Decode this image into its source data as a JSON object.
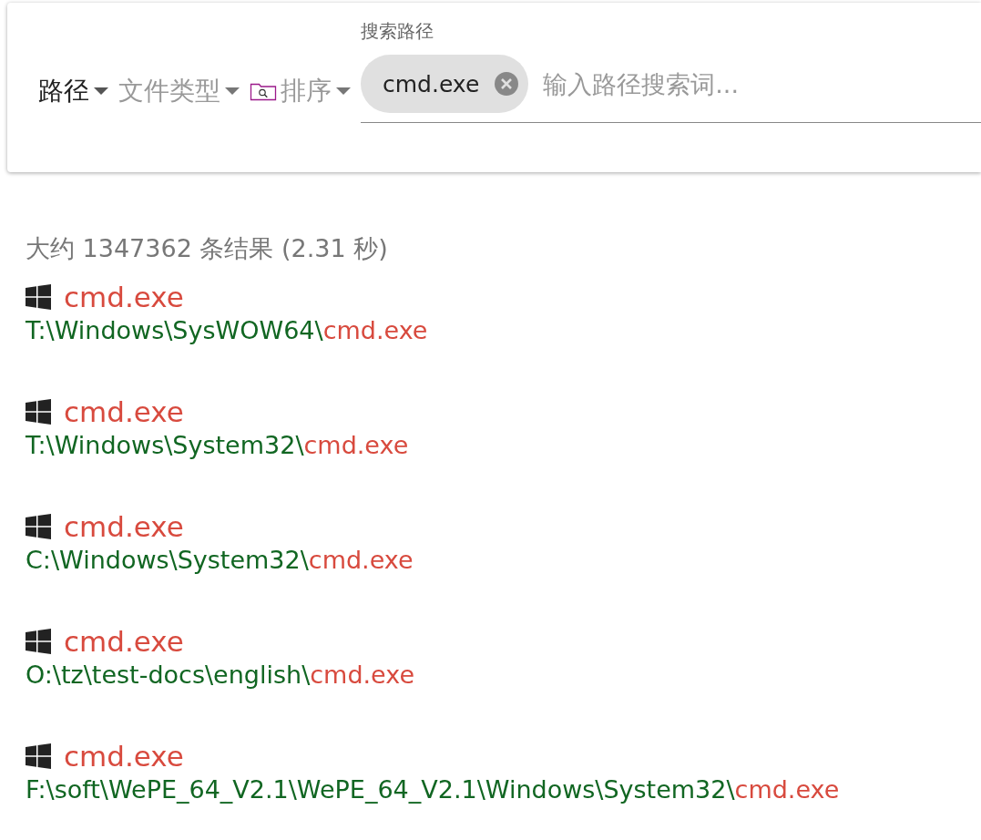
{
  "toolbar": {
    "filters": [
      {
        "kind": "plain",
        "label": "路径",
        "active": true
      },
      {
        "kind": "plain",
        "label": "文件类型",
        "active": false
      },
      {
        "kind": "with-icon",
        "label": "排序",
        "active": false
      }
    ],
    "search": {
      "label": "搜索路径",
      "chips": [
        {
          "text": "cmd.exe"
        }
      ],
      "placeholder": "输入路径搜索词..."
    }
  },
  "summary": "大约 1347362 条结果 (2.31 秒)",
  "results": [
    {
      "name": "cmd.exe",
      "dir": "T:\\Windows\\SysWOW64\\",
      "match": "cmd.exe"
    },
    {
      "name": "cmd.exe",
      "dir": "T:\\Windows\\System32\\",
      "match": "cmd.exe"
    },
    {
      "name": "cmd.exe",
      "dir": "C:\\Windows\\System32\\",
      "match": "cmd.exe"
    },
    {
      "name": "cmd.exe",
      "dir": "O:\\tz\\test-docs\\english\\",
      "match": "cmd.exe"
    },
    {
      "name": "cmd.exe",
      "dir": "F:\\soft\\WePE_64_V2.1\\WePE_64_V2.1\\Windows\\System32\\",
      "match": "cmd.exe"
    }
  ]
}
